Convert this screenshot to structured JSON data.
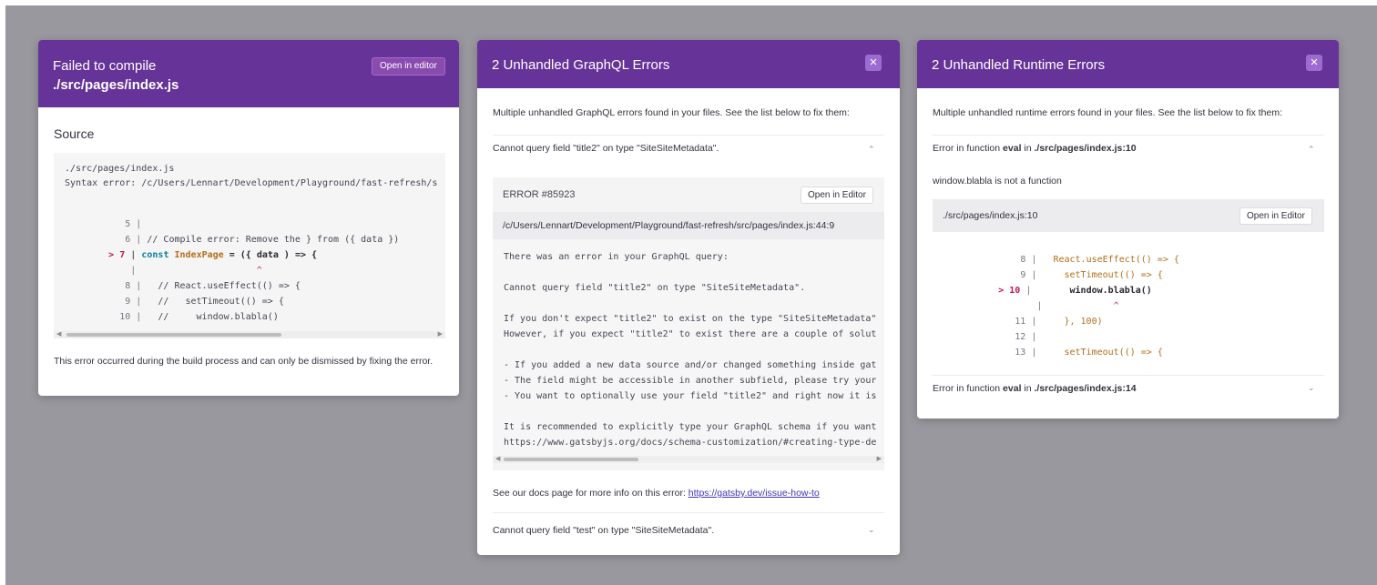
{
  "compile_panel": {
    "title": "Failed to compile",
    "file": "./src/pages/index.js",
    "open_button": "Open in editor",
    "source_heading": "Source",
    "code_path": "./src/pages/index.js",
    "code_syntax": "Syntax error: /c/Users/Lennart/Development/Playground/fast-refresh/s",
    "lines": [
      {
        "num": "5",
        "sep": "|",
        "text": ""
      },
      {
        "num": "6",
        "sep": "|",
        "text": "// Compile error: Remove the } from ({ data })"
      },
      {
        "num": "7",
        "sep": "|",
        "marker": ">",
        "kw": "const",
        "ident": "IndexPage",
        "rest": "= ({ data ) => {"
      },
      {
        "num": "",
        "sep": "|",
        "caret": "^"
      },
      {
        "num": "8",
        "sep": "|",
        "text": "// React.useEffect(() => {"
      },
      {
        "num": "9",
        "sep": "|",
        "text": "//   setTimeout(() => {"
      },
      {
        "num": "10",
        "sep": "|",
        "text": "//     window.blabla()"
      }
    ],
    "footer": "This error occurred during the build process and can only be dismissed by fixing the error."
  },
  "graphql_panel": {
    "title": "2 Unhandled GraphQL Errors",
    "close_icon": "×",
    "intro": "Multiple unhandled GraphQL errors found in your files. See the list below to fix them:",
    "errors": [
      {
        "summary": "Cannot query field \"title2\" on type \"SiteSiteMetadata\".",
        "chevron": "⌃"
      },
      {
        "summary": "Cannot query field \"test\" on type \"SiteSiteMetadata\".",
        "chevron": "⌄"
      }
    ],
    "detail": {
      "code": "ERROR #85923",
      "open_button": "Open in Editor",
      "path": "/c/Users/Lennart/Development/Playground/fast-refresh/src/pages/index.js:44:9",
      "lines": [
        "There was an error in your GraphQL query:",
        "",
        "Cannot query field \"title2\" on type \"SiteSiteMetadata\".",
        "",
        "If you don't expect \"title2\" to exist on the type \"SiteSiteMetadata\"",
        "However, if you expect \"title2\" to exist there are a couple of solut",
        "",
        "- If you added a new data source and/or changed something inside gat",
        "- The field might be accessible in another subfield, please try your",
        "- You want to optionally use your field \"title2\" and right now it is",
        "",
        "It is recommended to explicitly type your GraphQL schema if you want",
        "https://www.gatsbyjs.org/docs/schema-customization/#creating-type-de"
      ]
    },
    "docs_prefix": "See our docs page for more info on this error: ",
    "docs_link": "https://gatsby.dev/issue-how-to"
  },
  "runtime_panel": {
    "title": "2 Unhandled Runtime Errors",
    "close_icon": "×",
    "intro": "Multiple unhandled runtime errors found in your files. See the list below to fix them:",
    "errors": [
      {
        "prefix": "Error in function ",
        "fn": "eval",
        "mid": " in ",
        "file": "./src/pages/index.js:10",
        "chevron": "⌃"
      },
      {
        "prefix": "Error in function ",
        "fn": "eval",
        "mid": " in ",
        "file": "./src/pages/index.js:14",
        "chevron": "⌄"
      }
    ],
    "message": "window.blabla is not a function",
    "source_path": "./src/pages/index.js:10",
    "open_button": "Open in Editor",
    "lines": [
      {
        "num": "8",
        "text": "React.useEffect(() => {"
      },
      {
        "num": "9",
        "text": "  setTimeout(() => {"
      },
      {
        "num": "10",
        "marker": ">",
        "text": "    window.blabla()"
      },
      {
        "num": "",
        "caret": "^"
      },
      {
        "num": "11",
        "text": "  }, 100)"
      },
      {
        "num": "12",
        "text": ""
      },
      {
        "num": "13",
        "text": "  setTimeout(() => {"
      }
    ]
  }
}
